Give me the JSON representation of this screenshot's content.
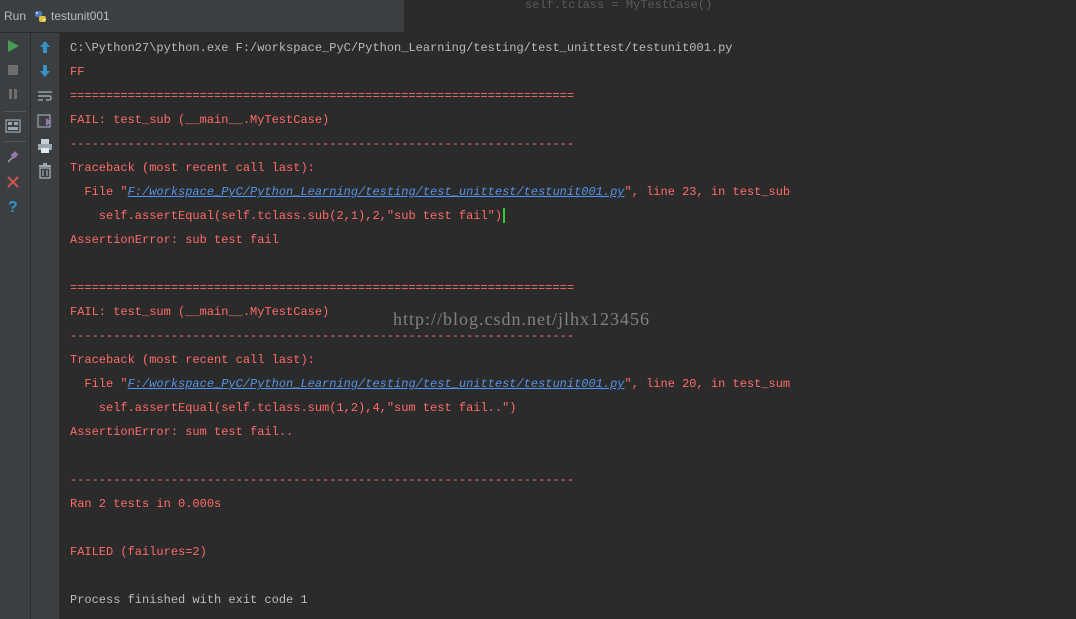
{
  "tool_window": {
    "label": "Run",
    "config_name": "testunit001"
  },
  "editor_sliver": "self.tclass = MyTestCase()",
  "console": {
    "command": "C:\\Python27\\python.exe F:/workspace_PyC/Python_Learning/testing/test_unittest/testunit001.py",
    "result_marks": "FF",
    "separator_double": "======================================================================",
    "separator_single": "----------------------------------------------------------------------",
    "failures": [
      {
        "header": "FAIL: test_sub (__main__.MyTestCase)",
        "traceback_header": "Traceback (most recent call last):",
        "file_prefix": "  File \"",
        "file_path": "F:/workspace_PyC/Python_Learning/testing/test_unittest/testunit001.py",
        "file_suffix": "\", line 23, in test_sub",
        "code": "    self.assertEqual(self.tclass.sub(2,1),2,\"sub test fail\")",
        "error": "AssertionError: sub test fail"
      },
      {
        "header": "FAIL: test_sum (__main__.MyTestCase)",
        "traceback_header": "Traceback (most recent call last):",
        "file_prefix": "  File \"",
        "file_path": "F:/workspace_PyC/Python_Learning/testing/test_unittest/testunit001.py",
        "file_suffix": "\", line 20, in test_sum",
        "code": "    self.assertEqual(self.tclass.sum(1,2),4,\"sum test fail..\")",
        "error": "AssertionError: sum test fail.."
      }
    ],
    "ran_summary": "Ran 2 tests in 0.000s",
    "failed_summary": "FAILED (failures=2)",
    "process_finished": "Process finished with exit code 1"
  },
  "watermark": "http://blog.csdn.net/jlhx123456",
  "icons": {
    "run": "play-icon",
    "stop": "stop-icon",
    "pause": "pause-icon",
    "up": "arrow-up-icon",
    "down": "arrow-down-icon"
  },
  "colors": {
    "error_text": "#ff6b68",
    "plain_text": "#bbbbbb",
    "link": "#5394ec",
    "run_green": "#499c54",
    "close_red": "#c75450",
    "help_blue": "#3592c4"
  }
}
